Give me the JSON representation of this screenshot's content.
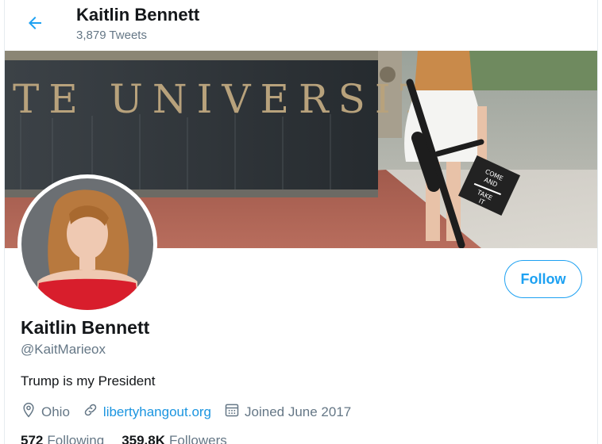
{
  "header": {
    "name": "Kaitlin Bennett",
    "tweet_count": "3,879 Tweets",
    "back_icon": "arrow-left-icon"
  },
  "banner": {
    "carved_text": "TE UNIVERSITY",
    "cap_text_1": "COME",
    "cap_text_2": "AND",
    "cap_text_3": "TAKE",
    "cap_text_4": "IT"
  },
  "profile": {
    "name": "Kaitlin Bennett",
    "handle": "@KaitMarieox",
    "bio": "Trump is my President",
    "follow_label": "Follow",
    "location": "Ohio",
    "website": "libertyhangout.org",
    "joined": "Joined June 2017"
  },
  "stats": {
    "following_count": "572",
    "following_label": "Following",
    "followers_count": "359.8K",
    "followers_label": "Followers"
  },
  "colors": {
    "accent": "#1da1f2",
    "link": "#1b95e0",
    "muted": "#657786",
    "text": "#14171a"
  }
}
